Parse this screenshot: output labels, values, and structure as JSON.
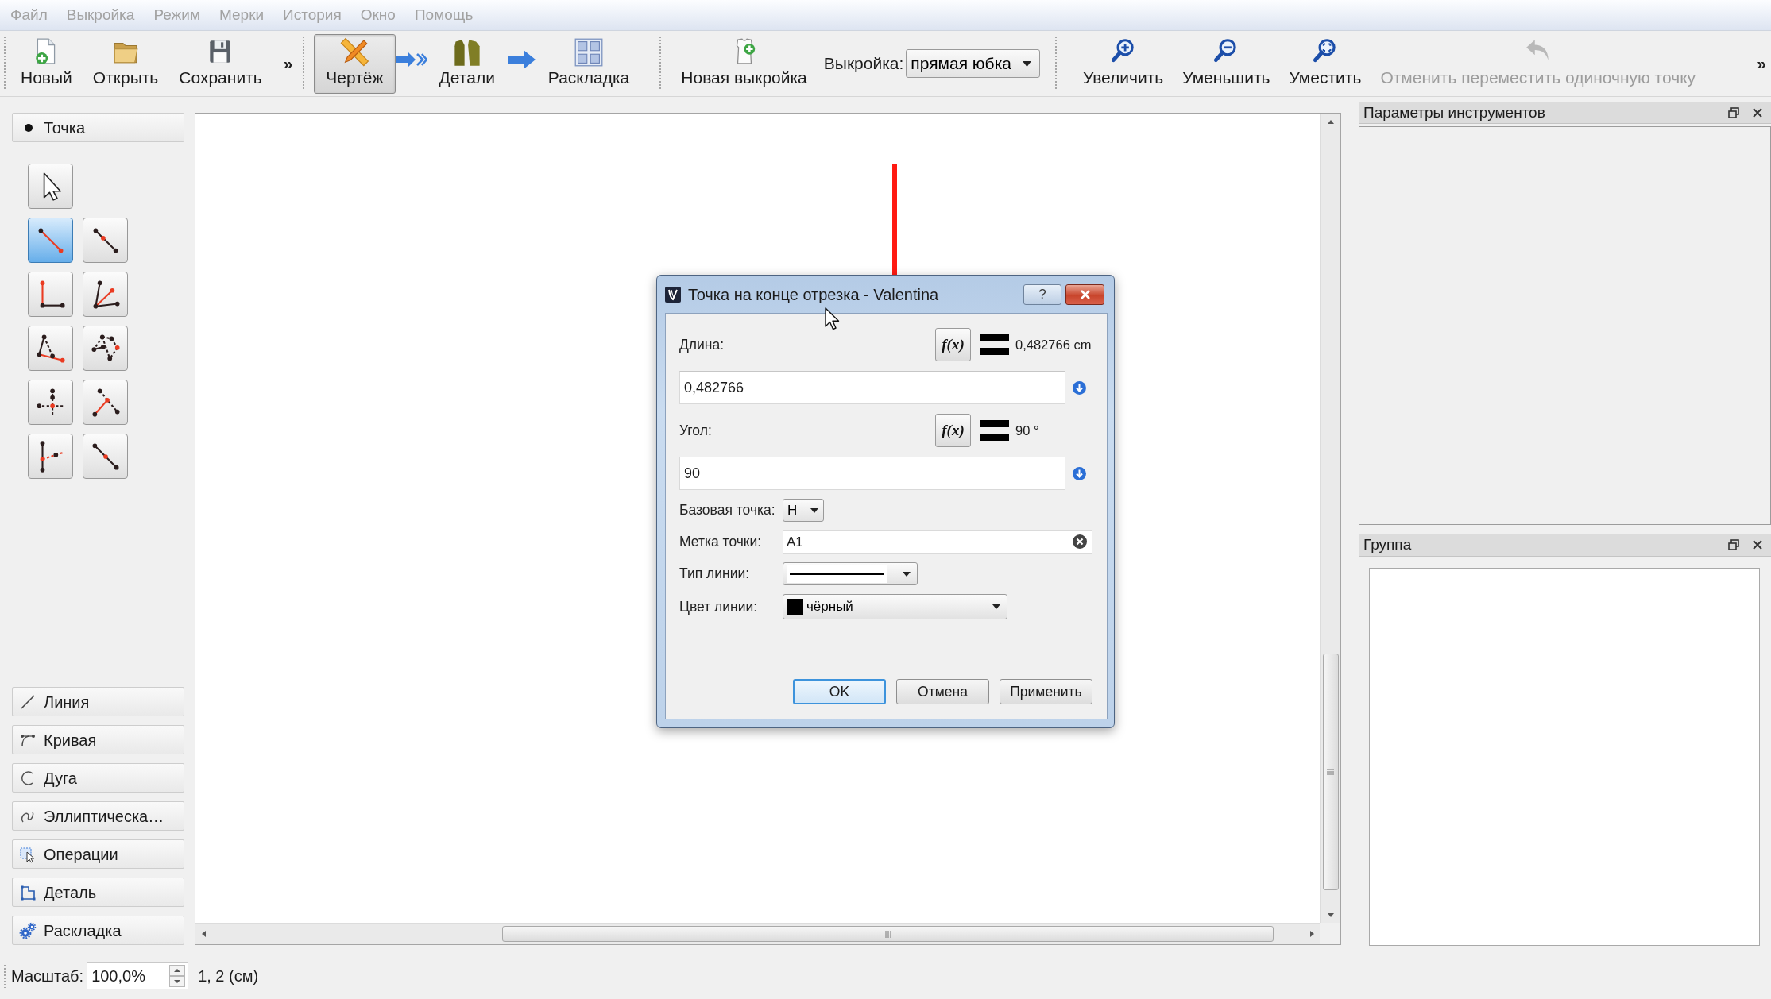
{
  "menu": [
    {
      "label": "Файл",
      "disabled": true
    },
    {
      "label": "Выкройка",
      "disabled": true
    },
    {
      "label": "Режим",
      "disabled": true
    },
    {
      "label": "Мерки",
      "disabled": true
    },
    {
      "label": "История",
      "disabled": true
    },
    {
      "label": "Окно",
      "disabled": true
    },
    {
      "label": "Помощь",
      "disabled": true
    }
  ],
  "toolbar": {
    "file_actions": [
      {
        "label": "Новый"
      },
      {
        "label": "Открыть"
      },
      {
        "label": "Сохранить"
      }
    ],
    "file_overflow": "»",
    "modes": [
      {
        "label": "Чертёж",
        "selected": true
      },
      {
        "label": "Детали",
        "selected": false
      },
      {
        "label": "Раскладка",
        "selected": false
      }
    ],
    "new_pattern": "Новая выкройка",
    "pattern_picker": {
      "label": "Выкройка:",
      "value": "прямая юбка"
    },
    "view_actions": [
      {
        "label": "Увеличить",
        "disabled": false
      },
      {
        "label": "Уменьшить",
        "disabled": false
      },
      {
        "label": "Уместить",
        "disabled": false
      },
      {
        "label": "Отменить переместить одиночную точку",
        "disabled": true
      }
    ],
    "overflow": "»"
  },
  "tool_box": {
    "point_section": "Точка",
    "tools": [
      {
        "selected": false
      },
      {
        "selected": true
      },
      {
        "selected": false
      },
      {
        "selected": false
      },
      {
        "selected": false
      },
      {
        "selected": false
      },
      {
        "selected": false
      },
      {
        "selected": false
      },
      {
        "selected": false
      },
      {
        "selected": false
      },
      {
        "selected": false
      }
    ],
    "sections": [
      "Линия",
      "Кривая",
      "Дуга",
      "Эллиптическа…",
      "Операции",
      "Деталь",
      "Раскладка"
    ]
  },
  "docks": [
    {
      "title": "Параметры инструментов"
    },
    {
      "title": "Группа"
    }
  ],
  "status_bar": {
    "zoom_label": "Масштаб:",
    "zoom_value": "100,0%",
    "coordinates": "1, 2 (см)"
  },
  "dialog": {
    "title": "Точка на конце отрезка - Valentina",
    "help": "?",
    "length": {
      "label": "Длина:",
      "formula_button": "f(x)",
      "result": "0,482766 cm",
      "value": "0,482766"
    },
    "angle": {
      "label": "Угол:",
      "formula_button": "f(x)",
      "result": "90 °",
      "value": "90"
    },
    "base_point": {
      "label": "Базовая точка:",
      "value": "Н"
    },
    "point_label": {
      "label": "Метка точки:",
      "value": "A1"
    },
    "line_type": {
      "label": "Тип линии:"
    },
    "line_color": {
      "label": "Цвет линии:",
      "value": "чёрный",
      "color": "#000000"
    },
    "buttons": [
      {
        "label": "OK",
        "default": true
      },
      {
        "label": "Отмена",
        "default": false
      },
      {
        "label": "Применить",
        "default": false
      }
    ]
  }
}
